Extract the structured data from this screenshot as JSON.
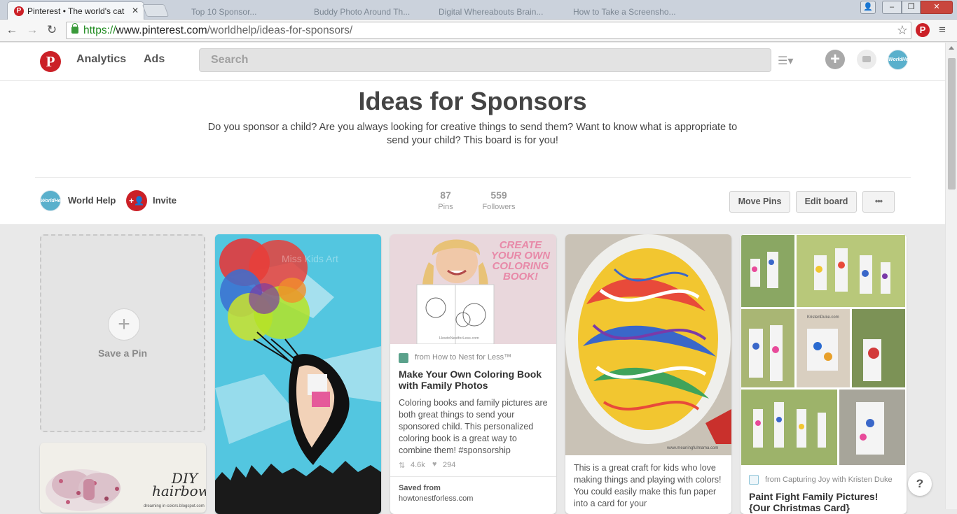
{
  "browser": {
    "active_tab": "Pinterest • The world's cat",
    "ghost_tabs": [
      "Top 10 Sponsor...",
      "Buddy Photo Around Th...",
      "Digital Whereabouts Brain...",
      "How to Take a Screensho..."
    ],
    "url_scheme": "https://",
    "url_host": "www.pinterest.com",
    "url_path": "/worldhelp/ideas-for-sponsors/",
    "ext_icon": "P",
    "minimize": "–",
    "maximize": "❐",
    "close": "✕"
  },
  "header": {
    "logo": "P",
    "nav": [
      "Analytics",
      "Ads"
    ],
    "search_placeholder": "Search",
    "avatar_text": "WorldHelp"
  },
  "board": {
    "title": "Ideas for Sponsors",
    "description": "Do you sponsor a child? Are you always looking for creative things to send them? Want to know what is appropriate to send your child? This board is for you!",
    "owner": "World Help",
    "invite": "Invite",
    "stats": [
      {
        "num": "87",
        "label": "Pins"
      },
      {
        "num": "559",
        "label": "Followers"
      }
    ],
    "buttons": [
      "Move Pins",
      "Edit board",
      "•••"
    ]
  },
  "save_pin": {
    "label": "Save a Pin",
    "plus": "+"
  },
  "pins": {
    "diy": {
      "line1": "DIY",
      "line2": "hairbows",
      "line3": "dreaming in-colors.blogspot.com"
    },
    "balloon": {
      "watermark": "Miss Kids Art"
    },
    "coloring": {
      "image_text": "CREATE YOUR OWN COLORING BOOK!",
      "watermark": "HowtoNestforLess.com",
      "from": "from How to Nest for Less™",
      "title": "Make Your Own Coloring Book with Family Photos",
      "description": "Coloring books and family pictures are both great things to send your sponsored child. This personalized coloring book is a great way to combine them! #sponsorship",
      "repins": "4.6k",
      "likes": "294",
      "saved_label": "Saved from",
      "saved_site": "howtonestforless.com"
    },
    "marble": {
      "watermark": "www.meaningfulmama.com",
      "description": "This is a great craft for kids who love making things and playing with colors! You could easily make this fun paper into a card for your"
    },
    "paint": {
      "box_label": "KristenDuke.com",
      "from": "from Capturing Joy with Kristen Duke",
      "title": "Paint Fight Family Pictures! {Our Christmas Card}"
    }
  },
  "help": "?",
  "colors": {
    "brand_red": "#cb2027",
    "avatar_blue": "#5ab0cc"
  }
}
